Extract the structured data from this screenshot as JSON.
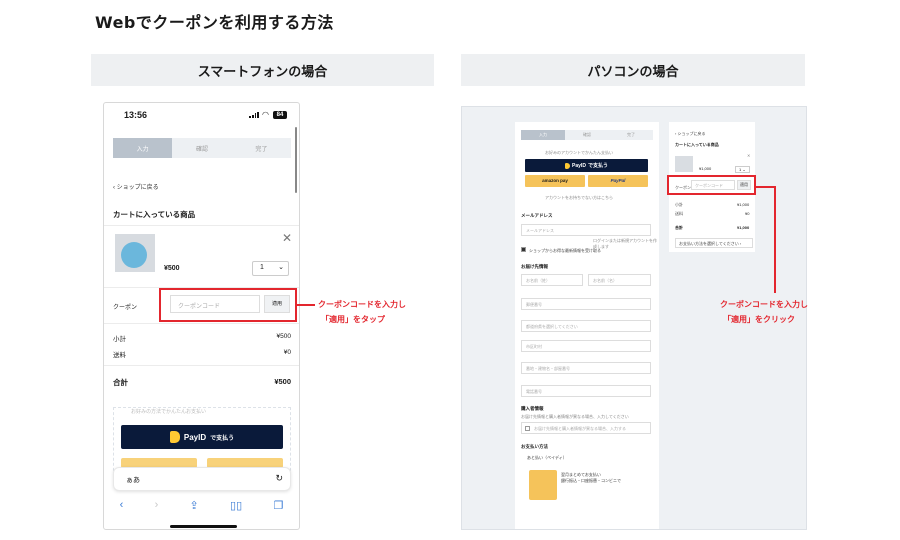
{
  "title": "Webでクーポンを利用する方法",
  "sections": {
    "smartphone": "スマートフォンの場合",
    "pc": "パソコンの場合"
  },
  "phone": {
    "time": "13:56",
    "battery": "84",
    "steps": [
      "入力",
      "確認",
      "完了"
    ],
    "back_link": "ショップに戻る",
    "cart_title": "カートに入っている商品",
    "price": "¥500",
    "qty": "1",
    "coupon_label": "クーポン",
    "coupon_placeholder": "クーポンコード",
    "coupon_apply": "適用",
    "subtotal_label": "小計",
    "subtotal_value": "¥500",
    "shipping_label": "送料",
    "shipping_value": "¥0",
    "total_label": "合計",
    "total_value": "¥500",
    "pay_note": "お好みの方法でかんたんお支払い",
    "payid_label": "PayID",
    "payid_suffix": "で支払う",
    "keyboard_text": "ぁあ",
    "note_line1": "クーポンコードを入力し",
    "note_line2": "「適用」をタップ"
  },
  "pc": {
    "steps": [
      "入力",
      "確認",
      "完了"
    ],
    "pay_note": "お好みのアカウントでかんたん支払い",
    "payid_label": "PayID",
    "payid_suffix": "で支払う",
    "amazon_label": "amazon pay",
    "paypal_label": "PayPal",
    "divider": "アカウントをお持ちでない方はこちら",
    "email_label": "メールアドレス",
    "email_placeholder": "メールアドレス",
    "email_hint": "ログインまたは新規アカウントを作成します",
    "checkbox_label": "ショップからお得な最新情報を受け取る",
    "shipping_info_label": "お届け先情報",
    "surname_placeholder": "お名前（姓）",
    "given_placeholder": "お名前（名）",
    "postal_placeholder": "郵便番号",
    "prefecture_placeholder": "都道府県を選択してください",
    "city_placeholder": "市区町村",
    "street_placeholder": "番地・建物名・部屋番号",
    "phone_placeholder": "電話番号",
    "buyer_label": "購入者情報",
    "buyer_hint": "お届け先情報と購入者情報が異なる場合、入力してください",
    "buyer_check": "お届け先情報と購入者情報が異なる場合、入力する",
    "payment_label": "お支払い方法",
    "payment_method": "あと払い（ペイディ）",
    "payment_desc_1": "翌月まとめてお支払い",
    "payment_desc_2": "銀行振込・口座振替・コンビニで",
    "cart_back": "ショップに戻る",
    "cart_title": "カートに入っている商品",
    "cart_item_price": "¥1,000",
    "cart_qty": "1",
    "coupon_label": "クーポン",
    "coupon_placeholder": "クーポンコード",
    "coupon_apply": "適用",
    "subtotal_label": "小計",
    "subtotal_value": "¥1,000",
    "shipping_label": "送料",
    "shipping_value": "¥0",
    "total_label": "合計",
    "total_value": "¥1,000",
    "add_link": "お支払い方法を選択してください",
    "note_line1": "クーポンコードを入力し",
    "note_line2": "「適用」をクリック"
  },
  "colors": {
    "accent_red": "#e3262e",
    "payid_navy": "#0a1a3a",
    "payid_yellow": "#ffc933"
  }
}
